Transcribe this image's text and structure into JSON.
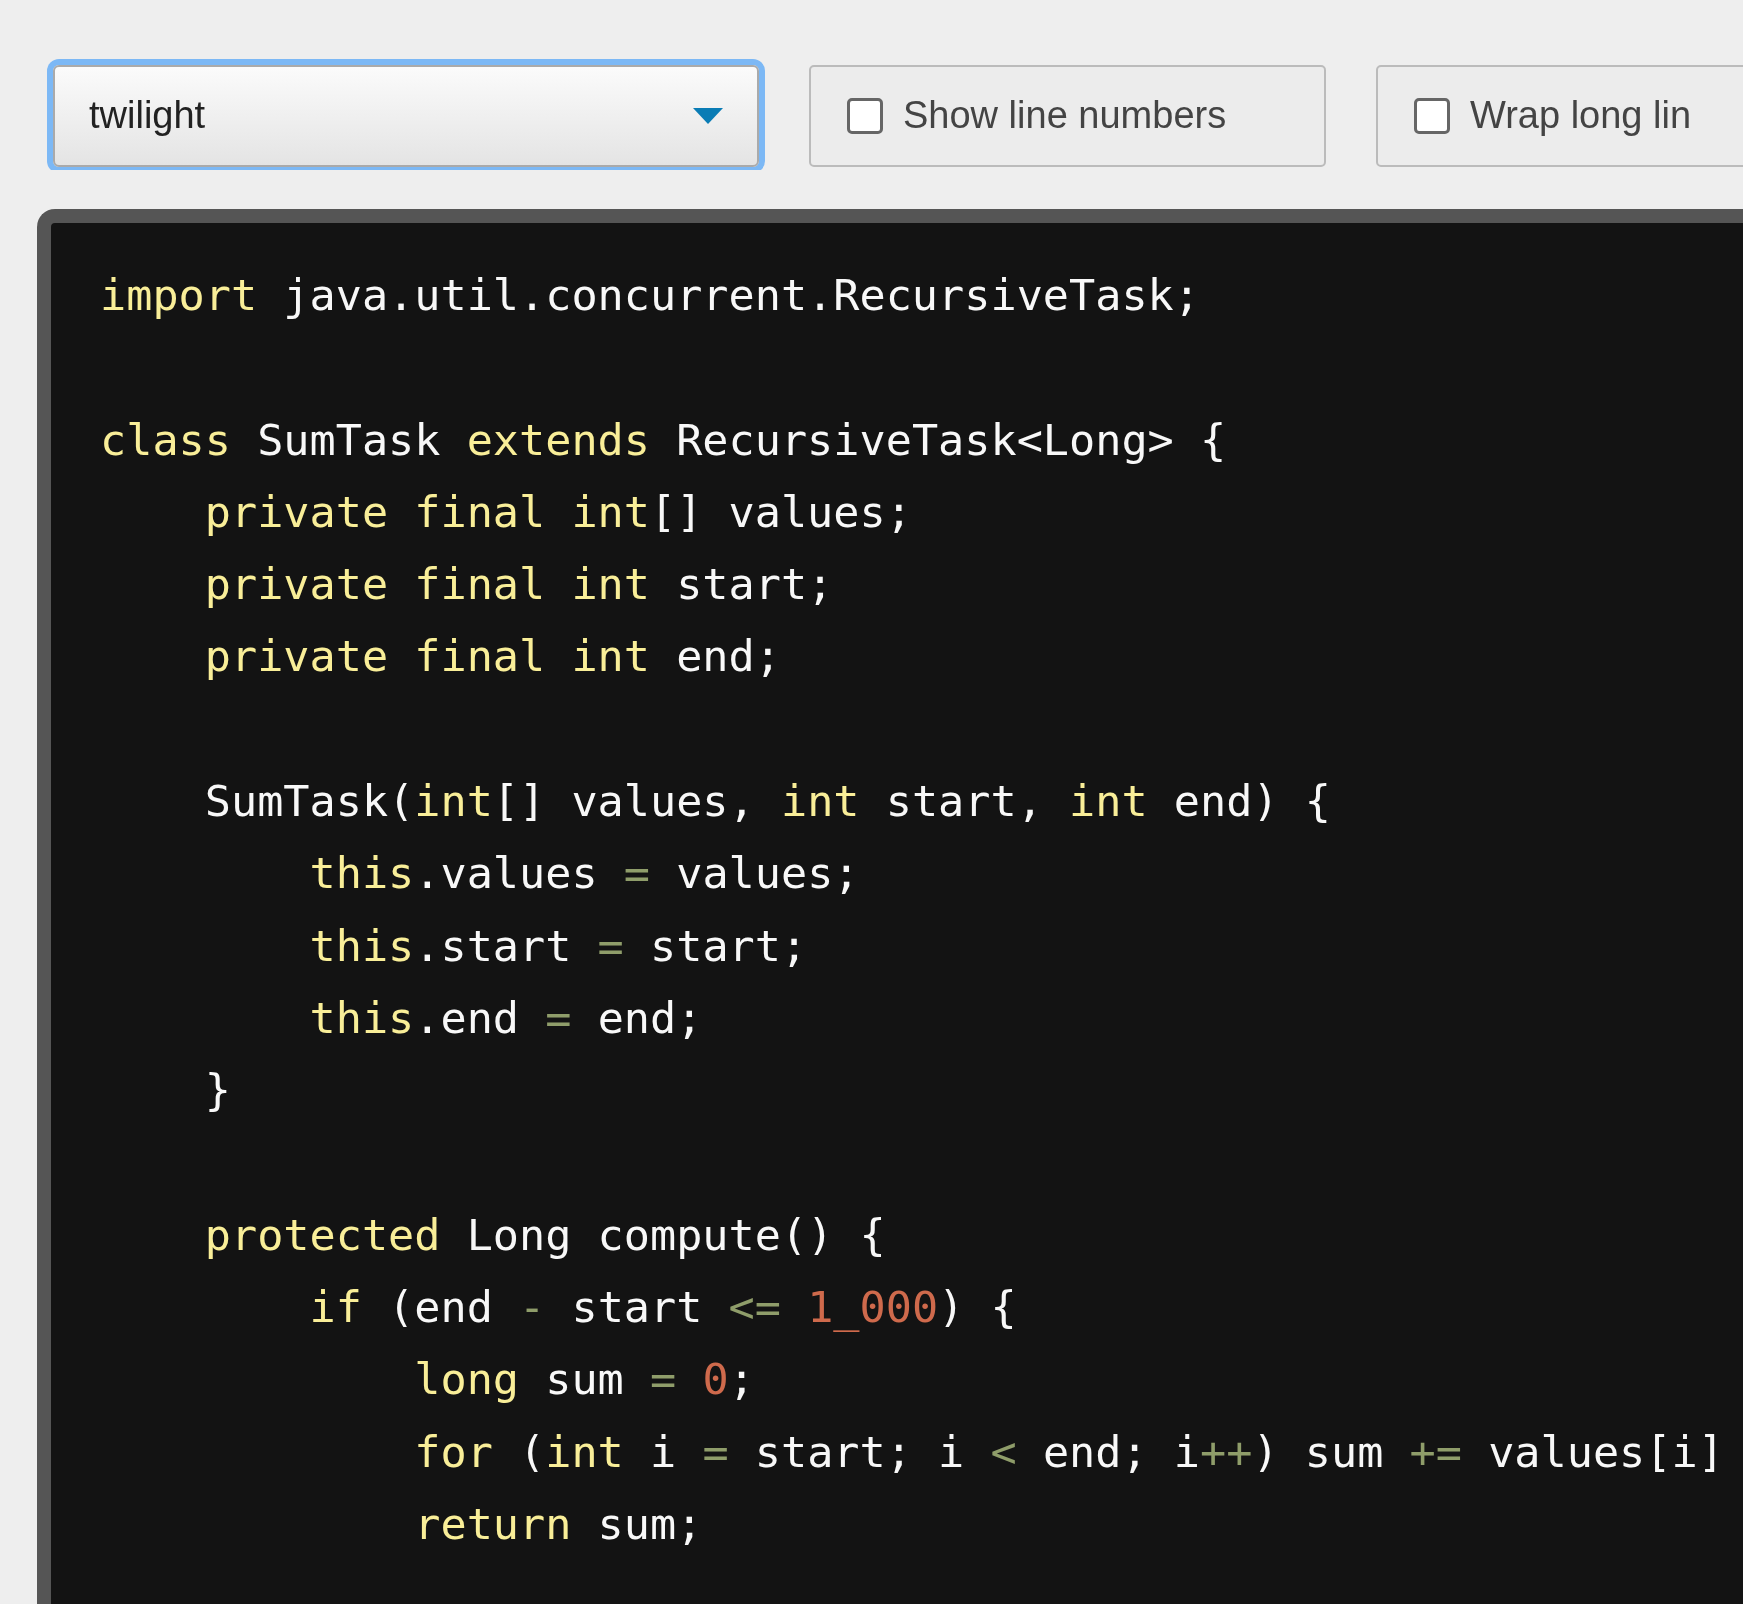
{
  "theme_select": {
    "value": "twilight",
    "focused": true
  },
  "options": [
    {
      "label": "Show line numbers",
      "checked": false
    },
    {
      "label": "Wrap long lin",
      "checked": false
    }
  ],
  "code": {
    "lines": [
      {
        "kind": "code",
        "tokens": [
          {
            "kind": "keyword",
            "text": "import"
          },
          {
            "kind": "plain",
            "text": " java.util.concurrent.RecursiveTask;"
          }
        ]
      },
      {
        "kind": "blank"
      },
      {
        "kind": "code",
        "tokens": [
          {
            "kind": "keyword",
            "text": "class"
          },
          {
            "kind": "plain",
            "text": " SumTask "
          },
          {
            "kind": "keyword",
            "text": "extends"
          },
          {
            "kind": "plain",
            "text": " RecursiveTask<Long> {"
          }
        ]
      },
      {
        "kind": "code",
        "tokens": [
          {
            "kind": "keyword",
            "text": "    private final int"
          },
          {
            "kind": "plain",
            "text": "[] values;"
          }
        ]
      },
      {
        "kind": "code",
        "tokens": [
          {
            "kind": "keyword",
            "text": "    private final int"
          },
          {
            "kind": "plain",
            "text": " start;"
          }
        ]
      },
      {
        "kind": "code",
        "tokens": [
          {
            "kind": "keyword",
            "text": "    private final int"
          },
          {
            "kind": "plain",
            "text": " end;"
          }
        ]
      },
      {
        "kind": "blank"
      },
      {
        "kind": "code",
        "tokens": [
          {
            "kind": "plain",
            "text": "    SumTask("
          },
          {
            "kind": "keyword",
            "text": "int"
          },
          {
            "kind": "plain",
            "text": "[] values, "
          },
          {
            "kind": "keyword",
            "text": "int"
          },
          {
            "kind": "plain",
            "text": " start, "
          },
          {
            "kind": "keyword",
            "text": "int"
          },
          {
            "kind": "plain",
            "text": " end) {"
          }
        ]
      },
      {
        "kind": "code",
        "tokens": [
          {
            "kind": "keyword",
            "text": "        this"
          },
          {
            "kind": "plain",
            "text": ".values "
          },
          {
            "kind": "operator",
            "text": "="
          },
          {
            "kind": "plain",
            "text": " values;"
          }
        ]
      },
      {
        "kind": "code",
        "tokens": [
          {
            "kind": "keyword",
            "text": "        this"
          },
          {
            "kind": "plain",
            "text": ".start "
          },
          {
            "kind": "operator",
            "text": "="
          },
          {
            "kind": "plain",
            "text": " start;"
          }
        ]
      },
      {
        "kind": "code",
        "tokens": [
          {
            "kind": "keyword",
            "text": "        this"
          },
          {
            "kind": "plain",
            "text": ".end "
          },
          {
            "kind": "operator",
            "text": "="
          },
          {
            "kind": "plain",
            "text": " end;"
          }
        ]
      },
      {
        "kind": "code",
        "tokens": [
          {
            "kind": "plain",
            "text": "    }"
          }
        ]
      },
      {
        "kind": "blank"
      },
      {
        "kind": "code",
        "tokens": [
          {
            "kind": "keyword",
            "text": "    protected"
          },
          {
            "kind": "plain",
            "text": " Long compute() {"
          }
        ]
      },
      {
        "kind": "code",
        "tokens": [
          {
            "kind": "keyword",
            "text": "        if"
          },
          {
            "kind": "plain",
            "text": " (end "
          },
          {
            "kind": "operator",
            "text": "-"
          },
          {
            "kind": "plain",
            "text": " start "
          },
          {
            "kind": "operator",
            "text": "<="
          },
          {
            "kind": "number",
            "text": " 1_000"
          },
          {
            "kind": "plain",
            "text": ") {"
          }
        ]
      },
      {
        "kind": "code",
        "tokens": [
          {
            "kind": "keyword",
            "text": "            long"
          },
          {
            "kind": "plain",
            "text": " sum "
          },
          {
            "kind": "operator",
            "text": "="
          },
          {
            "kind": "number",
            "text": " 0"
          },
          {
            "kind": "plain",
            "text": ";"
          }
        ]
      },
      {
        "kind": "code",
        "tokens": [
          {
            "kind": "keyword",
            "text": "            for"
          },
          {
            "kind": "plain",
            "text": " ("
          },
          {
            "kind": "keyword",
            "text": "int"
          },
          {
            "kind": "plain",
            "text": " i "
          },
          {
            "kind": "operator",
            "text": "="
          },
          {
            "kind": "plain",
            "text": " start; i "
          },
          {
            "kind": "operator",
            "text": "<"
          },
          {
            "kind": "plain",
            "text": " end; i"
          },
          {
            "kind": "operator",
            "text": "++"
          },
          {
            "kind": "plain",
            "text": ") sum "
          },
          {
            "kind": "operator",
            "text": "+="
          },
          {
            "kind": "plain",
            "text": " values[i]"
          }
        ]
      },
      {
        "kind": "code",
        "tokens": [
          {
            "kind": "keyword",
            "text": "            return"
          },
          {
            "kind": "plain",
            "text": " sum;"
          }
        ]
      }
    ]
  }
}
